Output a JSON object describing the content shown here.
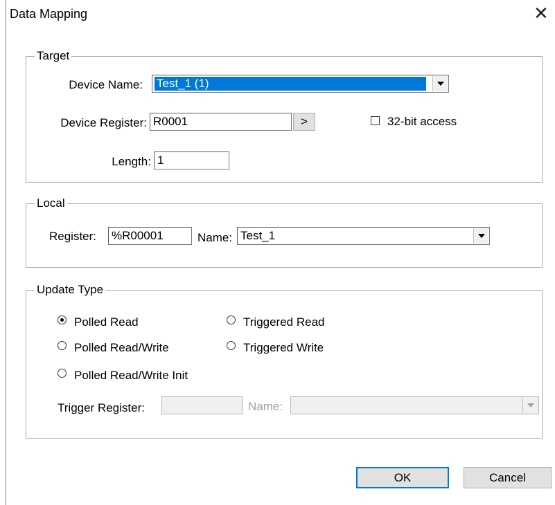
{
  "dialog": {
    "title": "Data Mapping",
    "close_glyph": "✕"
  },
  "target": {
    "legend": "Target",
    "device_name_label": "Device Name:",
    "device_name_value": "Test_1 (1)",
    "device_register_label": "Device Register:",
    "device_register_value": "R0001",
    "browse_label": ">",
    "access_32bit_label": "32-bit access",
    "access_32bit_checked": false,
    "length_label": "Length:",
    "length_value": "1"
  },
  "local": {
    "legend": "Local",
    "register_label": "Register:",
    "register_value": "%R00001",
    "name_label": "Name:",
    "name_value": "Test_1"
  },
  "update_type": {
    "legend": "Update Type",
    "options": [
      {
        "label": "Polled Read",
        "selected": true
      },
      {
        "label": "Polled Read/Write",
        "selected": false
      },
      {
        "label": "Polled Read/Write Init",
        "selected": false
      },
      {
        "label": "Triggered Read",
        "selected": false
      },
      {
        "label": "Triggered Write",
        "selected": false
      }
    ],
    "trigger_register_label": "Trigger Register:",
    "trigger_register_value": "",
    "trigger_name_label": "Name:",
    "trigger_name_value": ""
  },
  "buttons": {
    "ok": "OK",
    "cancel": "Cancel"
  },
  "colors": {
    "selection": "#0078d7",
    "group_border": "#a9a9a9",
    "button_face": "#e1e1e1"
  }
}
